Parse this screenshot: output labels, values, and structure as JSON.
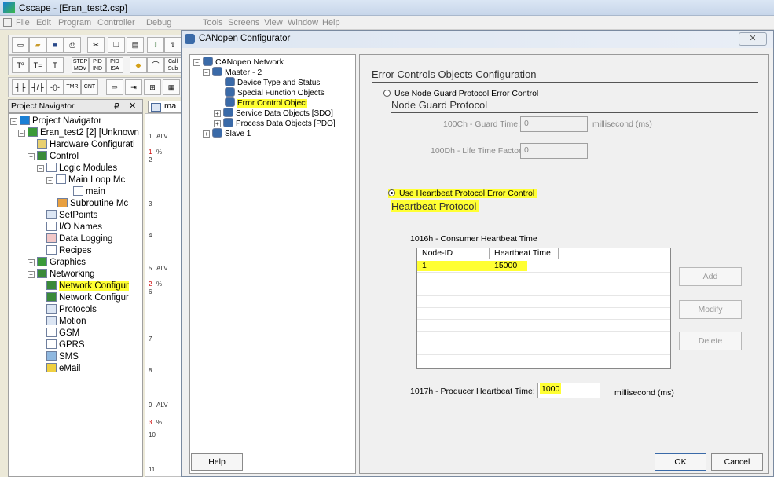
{
  "app": {
    "title": "Cscape - [Eran_test2.csp]"
  },
  "menu": [
    "File",
    "Edit",
    "Program",
    "Controller",
    "Debug",
    "Tools",
    "Screens",
    "View",
    "Window",
    "Help"
  ],
  "toolbar": {
    "step": "STEP",
    "pid": "PID",
    "ind": "IND",
    "isa": "ISA",
    "mov": "MOV",
    "tmr": "TMR",
    "cnt": "CNT",
    "call": "Call",
    "sub": "Sub",
    "t1": "T⁰",
    "t2": "T=",
    "t3": "T"
  },
  "navigator": {
    "header": "Project Navigator",
    "pin": "₽",
    "close": "✕",
    "items": [
      "Project Navigator",
      "Eran_test2 [2] [Unknown",
      "Hardware Configurati",
      "Control",
      "Logic Modules",
      "Main Loop Mc",
      "main",
      "Subroutine Mc",
      "SetPoints",
      "I/O Names",
      "Data Logging",
      "Recipes",
      "Graphics",
      "Networking",
      "Network Configur",
      "Network Configur",
      "Protocols",
      "Motion",
      "GSM",
      "GPRS",
      "SMS",
      "eMail"
    ],
    "tab": "ma"
  },
  "ladder": {
    "rungs": [
      "1",
      "2",
      "3",
      "4",
      "5",
      "6",
      "7",
      "8",
      "9",
      "10",
      "11"
    ],
    "red": [
      "1",
      "2",
      "3"
    ],
    "alv": "ALV",
    "pct": "%"
  },
  "dialog": {
    "title": "CANopen Configurator",
    "close": "✕",
    "tree": [
      "CANopen Network",
      "Master - 2",
      "Device Type and Status",
      "Special Function Objects",
      "Error Control Object",
      "Service Data Objects [SDO]",
      "Process Data Objects [PDO]",
      "Slave 1"
    ],
    "panel": {
      "title": "Error Controls Objects Configuration",
      "ng_radio": "Use Node Guard Protocol Error Control",
      "ng_title": "Node Guard Protocol",
      "guard_label": "100Ch - Guard Time:",
      "guard_value": "0",
      "guard_unit": "millisecond (ms)",
      "life_label": "100Dh - Life Time Factor:",
      "life_value": "0",
      "hb_radio": "Use Heartbeat Protocol Error Control",
      "hb_title": "Heartbeat Protocol",
      "consumer_label": "1016h - Consumer Heartbeat Time",
      "columns": [
        "Node-ID",
        "Heartbeat Time"
      ],
      "rows": [
        {
          "node": "1",
          "time": "15000"
        }
      ],
      "add": "Add",
      "modify": "Modify",
      "delete": "Delete",
      "producer_label": "1017h - Producer Heartbeat Time:",
      "producer_value": "1000",
      "producer_unit": "millisecond (ms)"
    },
    "help": "Help",
    "ok": "OK",
    "cancel": "Cancel"
  },
  "colors": {
    "highlight": "#ffff33",
    "title_bar": "#dbe6f4",
    "chrome": "#ece9d8"
  }
}
